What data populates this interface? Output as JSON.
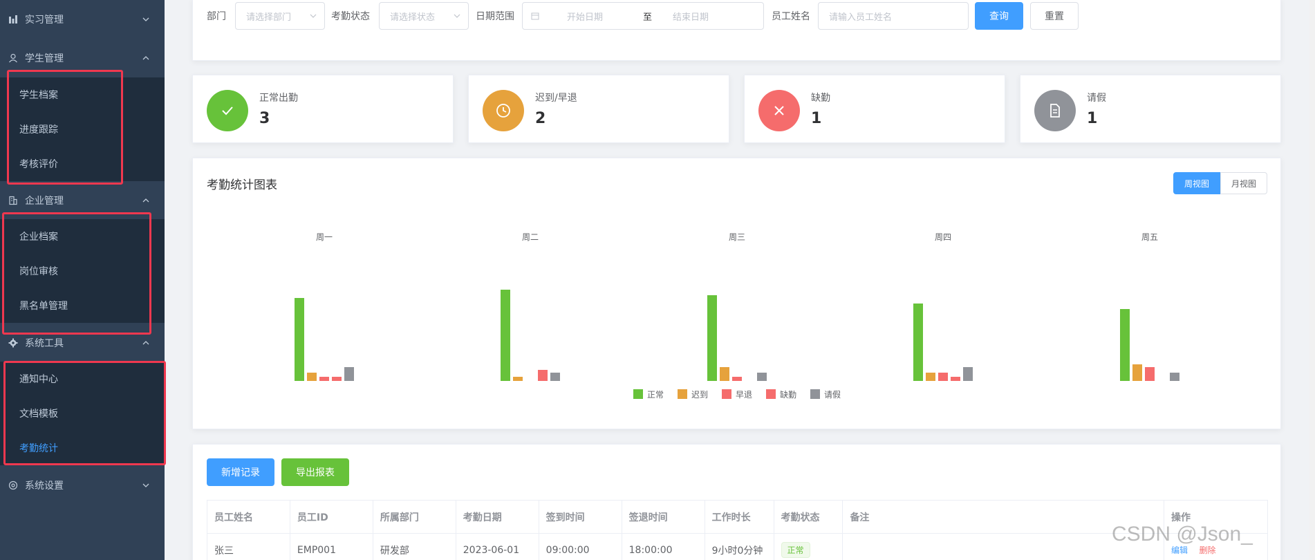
{
  "sidebar": {
    "groups": [
      {
        "label": "实习管理",
        "icon": "chart-icon",
        "expanded": false
      },
      {
        "label": "学生管理",
        "icon": "user-icon",
        "expanded": true,
        "items": [
          "学生档案",
          "进度跟踪",
          "考核评价"
        ]
      },
      {
        "label": "企业管理",
        "icon": "building-icon",
        "expanded": true,
        "items": [
          "企业档案",
          "岗位审核",
          "黑名单管理"
        ]
      },
      {
        "label": "系统工具",
        "icon": "gear-icon",
        "expanded": true,
        "items": [
          "通知中心",
          "文档模板",
          "考勤统计"
        ]
      },
      {
        "label": "系统设置",
        "icon": "settings-icon",
        "expanded": false
      }
    ],
    "active_item": "考勤统计"
  },
  "filters": {
    "dept_label": "部门",
    "dept_placeholder": "请选择部门",
    "status_label": "考勤状态",
    "status_placeholder": "请选择状态",
    "date_label": "日期范围",
    "start_placeholder": "开始日期",
    "range_sep": "至",
    "end_placeholder": "结束日期",
    "name_label": "员工姓名",
    "name_placeholder": "请输入员工姓名",
    "search_button": "查询",
    "reset_button": "重置"
  },
  "stats": [
    {
      "label": "正常出勤",
      "value": "3",
      "color": "#67c23a",
      "icon": "check-icon"
    },
    {
      "label": "迟到/早退",
      "value": "2",
      "color": "#e6a23c",
      "icon": "clock-icon"
    },
    {
      "label": "缺勤",
      "value": "1",
      "color": "#f56c6c",
      "icon": "close-icon"
    },
    {
      "label": "请假",
      "value": "1",
      "color": "#909399",
      "icon": "document-icon"
    }
  ],
  "chart_panel": {
    "title": "考勤统计图表",
    "week_view": "周视图",
    "month_view": "月视图"
  },
  "chart_data": {
    "type": "bar",
    "categories": [
      "周一",
      "周二",
      "周三",
      "周四",
      "周五"
    ],
    "series": [
      {
        "name": "正常",
        "color": "#67c23a",
        "values": [
          3.0,
          3.3,
          3.1,
          2.8,
          2.6
        ]
      },
      {
        "name": "迟到",
        "color": "#e6a23c",
        "values": [
          0.3,
          0.15,
          0.5,
          0.3,
          0.6
        ]
      },
      {
        "name": "早退",
        "color": "#f56c6c",
        "values": [
          0.15,
          0,
          0.15,
          0.3,
          0.5
        ]
      },
      {
        "name": "缺勤",
        "color": "#f56c6c",
        "values": [
          0.15,
          0.4,
          0,
          0.15,
          0
        ]
      },
      {
        "name": "请假",
        "color": "#909399",
        "values": [
          0.5,
          0.3,
          0.3,
          0.5,
          0.3
        ]
      }
    ],
    "legend_position": "bottom",
    "grid": false,
    "ylim": [
      0,
      4
    ]
  },
  "actions": {
    "add_button": "新增记录",
    "export_button": "导出报表"
  },
  "table": {
    "columns": [
      "员工姓名",
      "员工ID",
      "所属部门",
      "考勤日期",
      "签到时间",
      "签退时间",
      "工作时长",
      "考勤状态",
      "备注",
      "操作"
    ],
    "rows": [
      {
        "name": "张三",
        "id": "EMP001",
        "dept": "研发部",
        "date": "2023-06-01",
        "checkin": "09:00:00",
        "checkout": "18:00:00",
        "duration": "9小时0分钟",
        "status": "正常",
        "note": "",
        "edit": "编辑",
        "delete": "删除"
      }
    ]
  },
  "watermark": "CSDN @Json_"
}
